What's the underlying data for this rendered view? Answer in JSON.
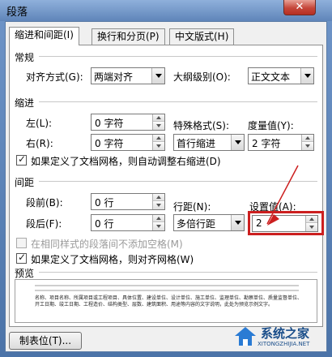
{
  "window": {
    "title": "段落",
    "close_glyph": "✕"
  },
  "tabs": [
    {
      "label": "缩进和间距(I)"
    },
    {
      "label": "换行和分页(P)"
    },
    {
      "label": "中文版式(H)"
    }
  ],
  "general": {
    "heading": "常规",
    "alignment_label": "对齐方式(G):",
    "alignment_value": "两端对齐",
    "outline_label": "大纲级别(O):",
    "outline_value": "正文文本"
  },
  "indent": {
    "heading": "缩进",
    "left_label": "左(L):",
    "left_value": "0 字符",
    "right_label": "右(R):",
    "right_value": "0 字符",
    "special_label": "特殊格式(S):",
    "special_value": "首行缩进",
    "by_label": "度量值(Y):",
    "by_value": "2 字符",
    "auto_adjust_label": "如果定义了文档网格，则自动调整右缩进(D)",
    "auto_adjust_checked": true
  },
  "spacing": {
    "heading": "间距",
    "before_label": "段前(B):",
    "before_value": "0 行",
    "after_label": "段后(F):",
    "after_value": "0 行",
    "line_label": "行距(N):",
    "line_value": "多倍行距",
    "at_label": "设置值(A):",
    "at_value": "2",
    "no_space_label": "在相同样式的段落间不添加空格(M)",
    "no_space_checked": false,
    "snap_grid_label": "如果定义了文档网格，则对齐网格(W)",
    "snap_grid_checked": true
  },
  "preview": {
    "heading": "预览",
    "sample_text": "名称、项目名称、所属项目或工程项目、具体位置、建设单位、设计单位、施工单位、监理单位、勘察单位、质量监督单位、开工日期、竣工日期、工程造价、结构类型、层数、建筑面积、用途等内容的文字说明，此处为预览示例文字。"
  },
  "buttons": {
    "tabstops_label": "制表位(T)..."
  },
  "watermark": {
    "name": "系统之家",
    "url": "XITONGZHIJIA.NET"
  },
  "colors": {
    "highlight": "#cc1f1f",
    "title_gradient": "#6f95c8"
  }
}
